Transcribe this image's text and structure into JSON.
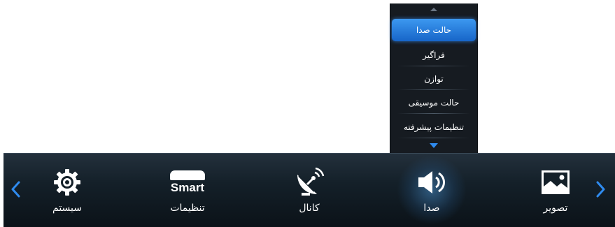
{
  "submenu": {
    "items": [
      {
        "label": "حالت صدا",
        "active": true
      },
      {
        "label": "فراگیر",
        "active": false
      },
      {
        "label": "توازن",
        "active": false
      },
      {
        "label": "حالت موسیقی",
        "active": false
      },
      {
        "label": "تنظیمات پیشرفته",
        "active": false
      }
    ]
  },
  "menubar": {
    "tiles": [
      {
        "label": "سیستم",
        "icon": "gear-icon"
      },
      {
        "label": "تنظیمات",
        "icon": "smart-settings-icon",
        "icon_text": "Smart"
      },
      {
        "label": "کانال",
        "icon": "satellite-dish-icon"
      },
      {
        "label": "صدا",
        "icon": "speaker-icon",
        "focused": true
      },
      {
        "label": "تصویر",
        "icon": "picture-icon"
      }
    ]
  },
  "colors": {
    "accent": "#2f8bef",
    "bar": "#142029",
    "submenu_bg": "#161b21"
  }
}
